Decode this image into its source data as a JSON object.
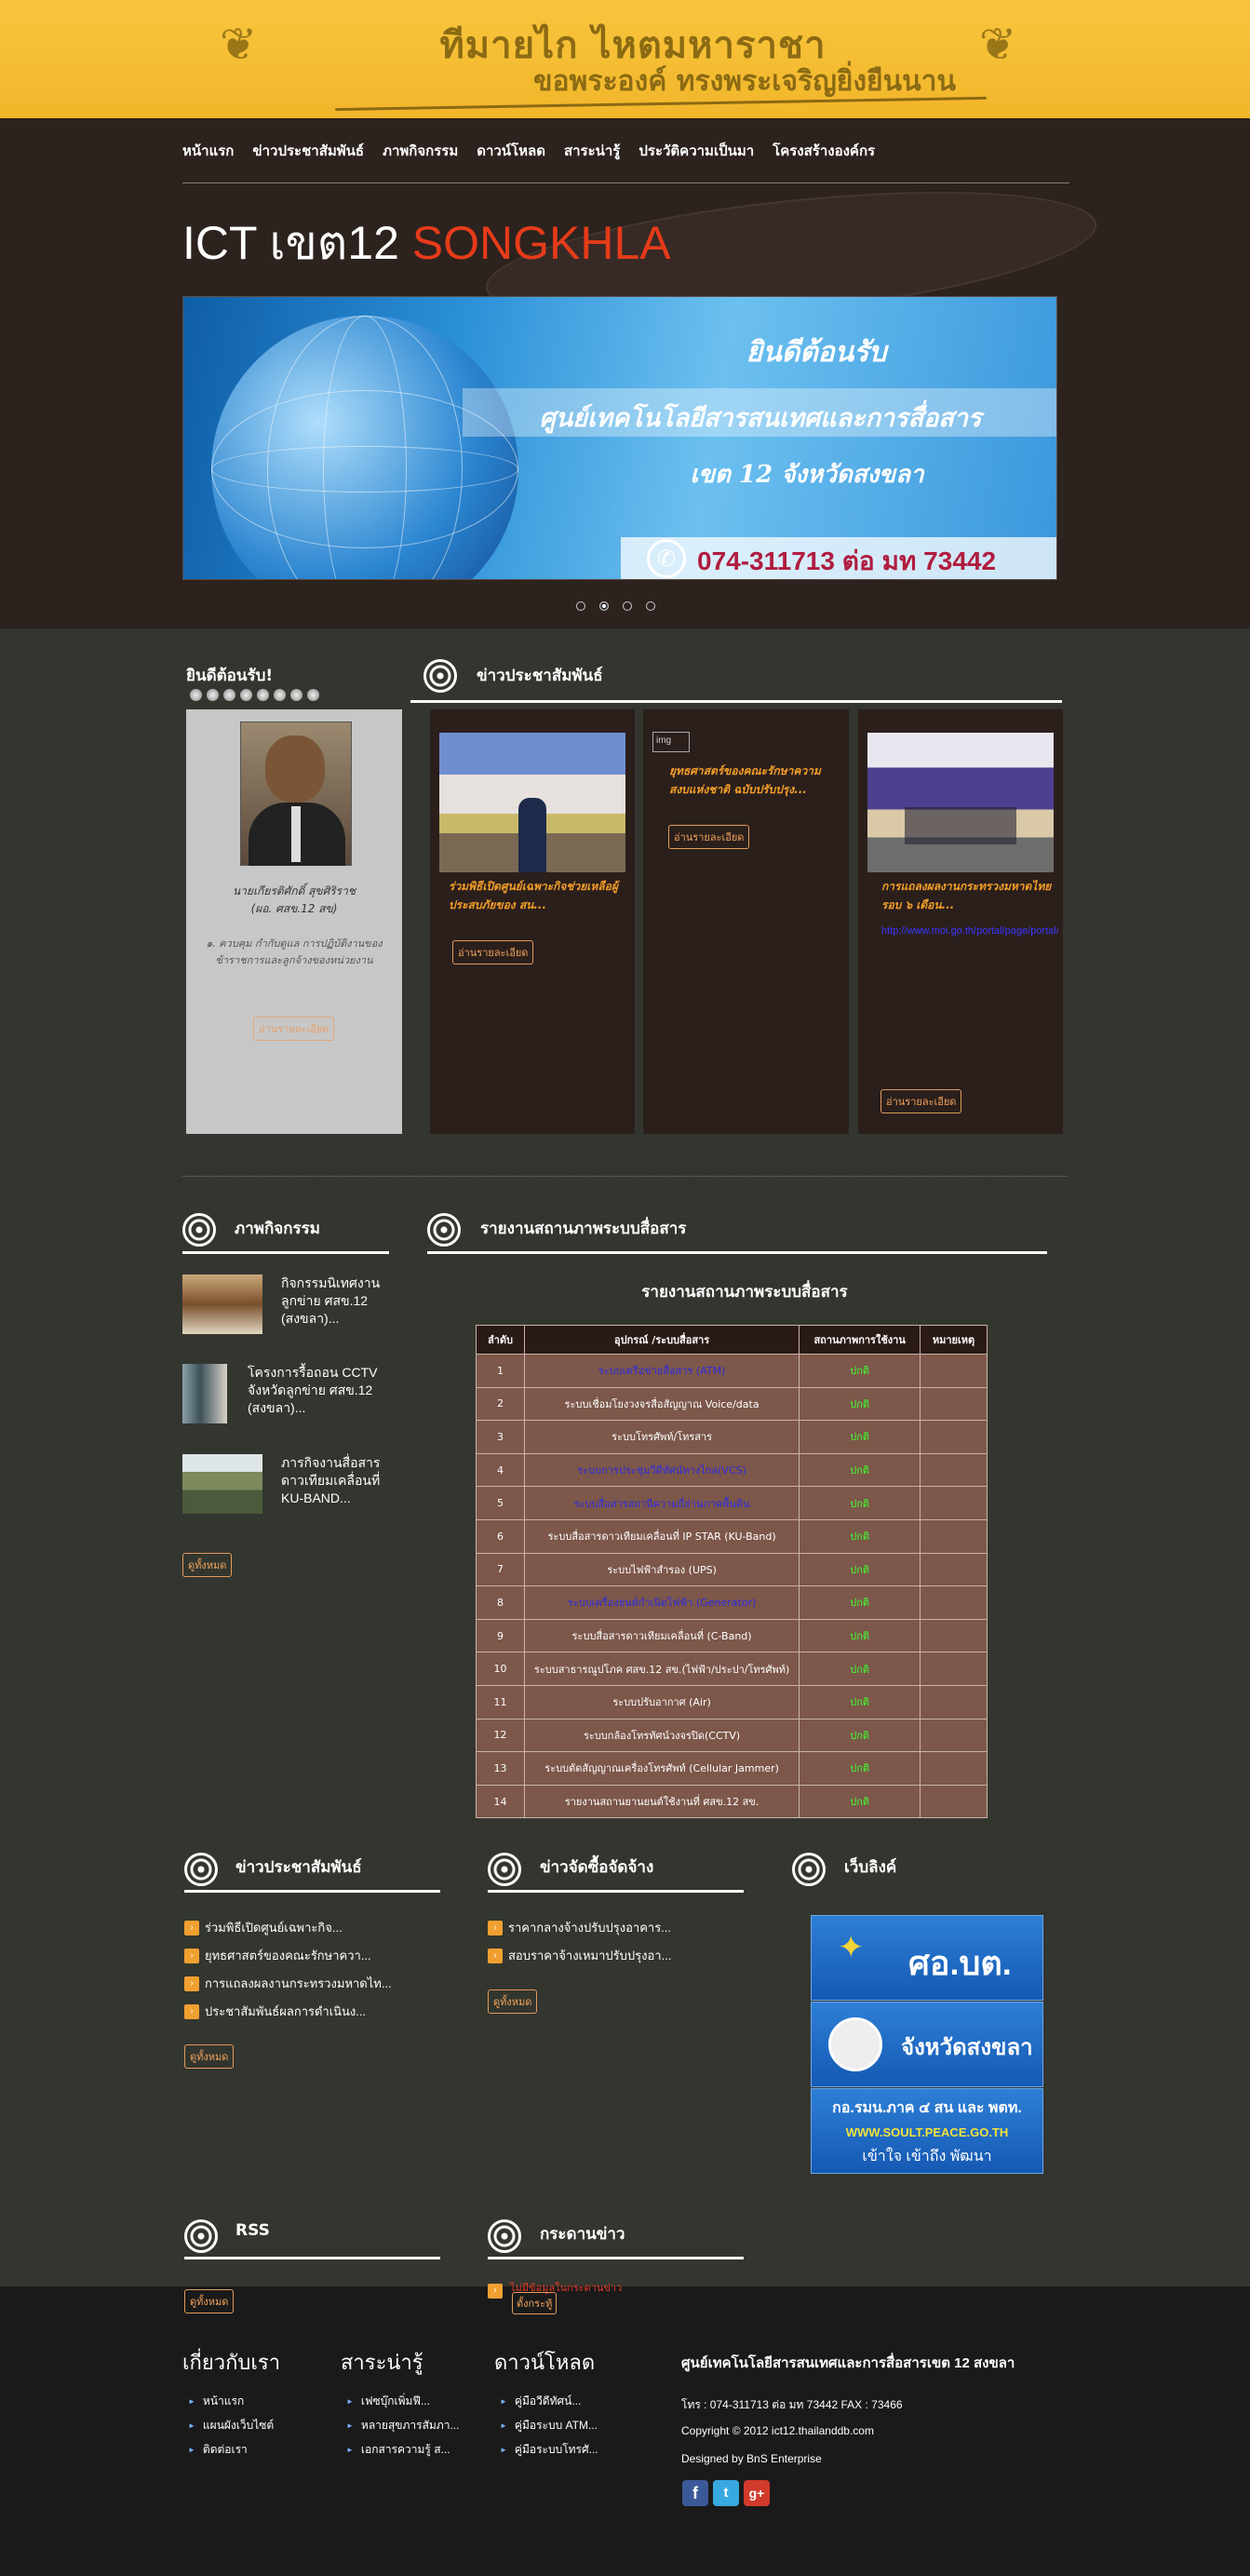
{
  "banner": {
    "title": "ทีมายไก ไหตมหาราชา",
    "subtitle": "ขอพระองค์ ทรงพระเจริญยิ่งยืนนาน"
  },
  "nav": [
    "หน้าแรก",
    "ข่าวประชาสัมพันธ์",
    "ภาพกิจกรรม",
    "ดาวน์โหลด",
    "สาระน่ารู้",
    "ประวัติความเป็นมา",
    "โครงสร้างองค์กร"
  ],
  "site_title": {
    "main": "ICT เขต12",
    "accent": "SONGKHLA"
  },
  "slider": {
    "heading": "ยินดีต้อนรับ",
    "line1": "ศูนย์เทคโนโลยีสารสนเทศและการสื่อสาร",
    "line2": "เขต 12 จังหวัดสงขลา",
    "phone": "074-311713 ต่อ มท 73442",
    "active_dot": 2
  },
  "welcome": {
    "title": "ยินดีต้อนรับ!",
    "name": "นายเกียรติศักดิ์ สุขศิริราช",
    "position": "(ผอ. ศสข.12 สข)",
    "desc": "๑. ควบคุม กำกับดูแล การปฏิบัติงานของข้าราชการและลูกจ้างของหน่วยงาน",
    "button": "อ่านรายละเอียด"
  },
  "pr": {
    "title": "ข่าวประชาสัมพันธ์",
    "cards": [
      {
        "caption": "ร่วมพิธีเปิดศูนย์เฉพาะกิจช่วยเหลือผู้ประสบภัยของ สน...",
        "button": "อ่านรายละเอียด"
      },
      {
        "img_alt": "img",
        "caption": "ยุทธศาสตร์ของคณะรักษาความสงบแห่งชาติ ฉบับปรับปรุง...",
        "button": "อ่านรายละเอียด"
      },
      {
        "caption": "การแถลงผลงานกระทรวงมหาดไทยรอบ ๖ เดือน...",
        "link": "http://www.moi.go.th/portal/page/portal/...",
        "button": "อ่านรายละเอียด"
      }
    ]
  },
  "activities": {
    "title": "ภาพกิจกรรม",
    "items": [
      "กิจกรรมนิเทศงานลูกข่าย ศสข.12 (สงขลา)...",
      "โครงการรื้อถอน CCTV จังหวัดลูกข่าย ศสข.12 (สงขลา)...",
      "ภารกิจงานสื่อสารดาวเทียมเคลื่อนที่ KU-BAND..."
    ],
    "button": "ดูทั้งหมด"
  },
  "status": {
    "section_title": "รายงานสถานภาพระบบสื่อสาร",
    "heading": "รายงานสถานภาพระบบสื่อสาร",
    "columns": [
      "ลำดับ",
      "อุปกรณ์ /ระบบสื่อสาร",
      "สถานภาพการใช้งาน",
      "หมายเหตุ"
    ],
    "rows": [
      {
        "no": "1",
        "name": "ระบบเครือข่ายสื่อสาร (ATM)",
        "status": "ปกติ",
        "link": true
      },
      {
        "no": "2",
        "name": "ระบบเชื่อมโยงวงจรสื่อสัญญาณ Voice/data",
        "status": "ปกติ",
        "link": false
      },
      {
        "no": "3",
        "name": "ระบบโทรศัพท์/โทรสาร",
        "status": "ปกติ",
        "link": false
      },
      {
        "no": "4",
        "name": "ระบบการประชุมวีดีทัศน์ทางไกล(VCS)",
        "status": "ปกติ",
        "link": true
      },
      {
        "no": "5",
        "name": "ระบบสื่อสารสถานีความถี่ย่านภาคพื้นดิน",
        "status": "ปกติ",
        "link": true
      },
      {
        "no": "6",
        "name": "ระบบสื่อสารดาวเทียมเคลื่อนที่ IP STAR (KU-Band)",
        "status": "ปกติ",
        "link": false
      },
      {
        "no": "7",
        "name": "ระบบไฟฟ้าสำรอง (UPS)",
        "status": "ปกติ",
        "link": false
      },
      {
        "no": "8",
        "name": "ระบบเครื่องยนต์กำเนิดไฟฟ้า (Generator)",
        "status": "ปกติ",
        "link": true
      },
      {
        "no": "9",
        "name": "ระบบสื่อสารดาวเทียมเคลื่อนที่ (C-Band)",
        "status": "ปกติ",
        "link": false
      },
      {
        "no": "10",
        "name": "ระบบสาธารณูปโภค ศสข.12 สข.(ไฟฟ้า/ประปา/โทรศัพท์)",
        "status": "ปกติ",
        "link": false
      },
      {
        "no": "11",
        "name": "ระบบปรับอากาศ (Air)",
        "status": "ปกติ",
        "link": false
      },
      {
        "no": "12",
        "name": "ระบบกล้องโทรทัศน์วงจรปิด(CCTV)",
        "status": "ปกติ",
        "link": false
      },
      {
        "no": "13",
        "name": "ระบบตัดสัญญาณเครื่องโทรศัพท์ (Cellular Jammer)",
        "status": "ปกติ",
        "link": false
      },
      {
        "no": "14",
        "name": "รายงานสถานยานยนต์ใช้งานที่ ศสข.12 สข.",
        "status": "ปกติ",
        "link": false
      }
    ]
  },
  "bottom": {
    "news": {
      "title": "ข่าวประชาสัมพันธ์",
      "items": [
        "ร่วมพิธีเปิดศูนย์เฉพาะกิจ...",
        "ยุทธศาสตร์ของคณะรักษาควา...",
        "การแถลงผลงานกระทรวงมหาดไท...",
        "ประชาสัมพันธ์ผลการดำเนินง..."
      ],
      "button": "ดูทั้งหมด"
    },
    "procure": {
      "title": "ข่าวจัดซื้อจัดจ้าง",
      "items": [
        "ราคากลางจ้างปรับปรุงอาคาร...",
        "สอบราคาจ้างเหมาปรับปรุงอา..."
      ],
      "button": "ดูทั้งหมด"
    },
    "weblinks": {
      "title": "เว็บลิงค์",
      "items": [
        "ศอ.บต.",
        "จังหวัดสงขลา",
        "กอ.รมน.ภาค ๔ สน และ พตท.",
        "WWW.SOULT.PEACE.GO.TH",
        "เข้าใจ เข้าถึง พัฒนา"
      ]
    },
    "rss": {
      "title": "RSS",
      "button": "ดูทั้งหมด"
    },
    "board": {
      "title": "กระดานข่าว",
      "link": "ไม่มีข้อมูลในกระดานข่าว",
      "button": "ตั้งกระทู้"
    }
  },
  "footer": {
    "about": {
      "title": "เกี่ยวกับเรา",
      "items": [
        "หน้าแรก",
        "แผนผังเว็บไซต์",
        "ติดต่อเรา"
      ]
    },
    "knowledge": {
      "title": "สาระน่ารู้",
      "items": [
        "เฟซบุ๊กเพิ่มฟี...",
        "หลายสุขภารสัมภา...",
        "เอกสารความรู้ ส..."
      ]
    },
    "download": {
      "title": "ดาวน์โหลด",
      "items": [
        "คู่มือวีดีทัศน์...",
        "คู่มือระบบ ATM...",
        "คู่มือระบบโทรศั..."
      ]
    },
    "org": {
      "title": "ศูนย์เทคโนโลยีสารสนเทศและการสื่อสารเขต 12 สงขลา",
      "phone": "โทร : 074-311713 ต่อ มท 73442 FAX : 73466",
      "copyright": "Copyright © 2012 ict12.thailanddb.com",
      "designed": "Designed by BnS Enterprise"
    },
    "social": [
      "f",
      "t",
      "g+"
    ]
  },
  "colors": {
    "banner": "#f5bd33",
    "header": "#2c221e",
    "body": "#33362f",
    "accent": "#e53b19",
    "card_text": "#f39d28",
    "ok": "#40ff2e",
    "footer": "#1a1a1a"
  }
}
